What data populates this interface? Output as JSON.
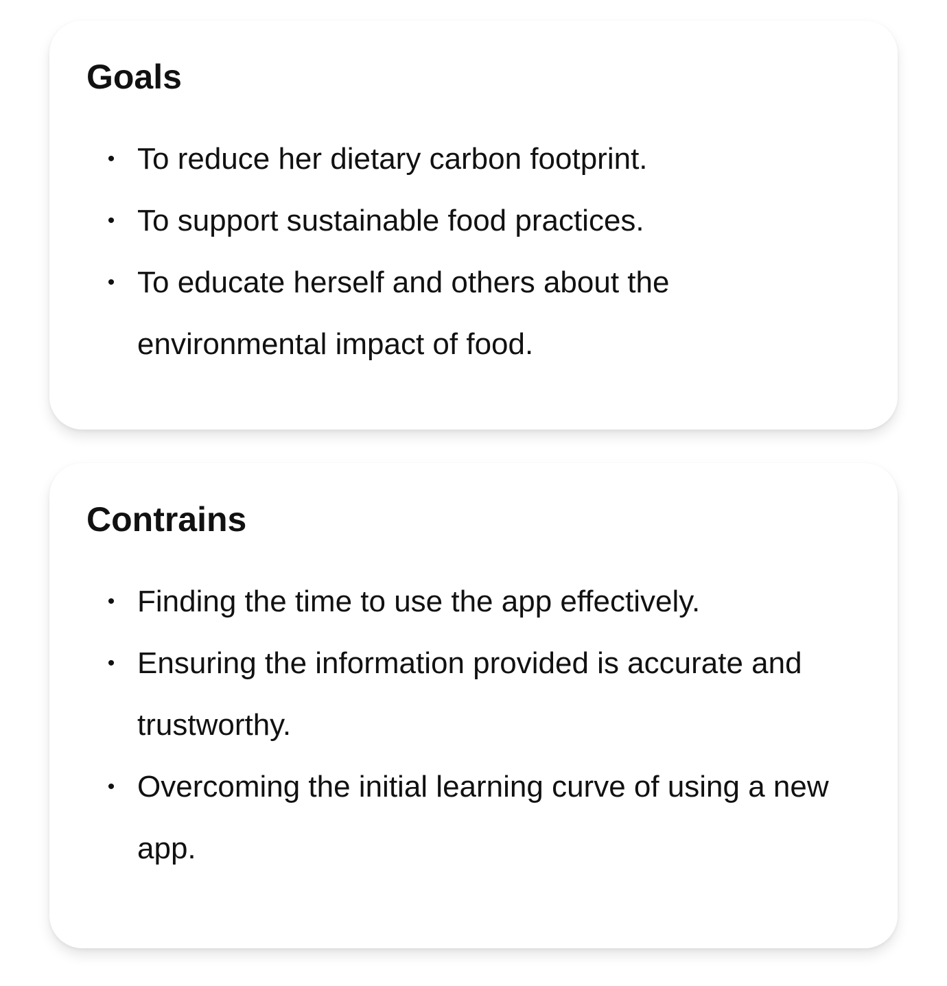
{
  "goals": {
    "title": "Goals",
    "items": [
      "To reduce her dietary carbon footprint.",
      "To support sustainable food practices.",
      "To educate herself and others about the environmental impact of food."
    ]
  },
  "constraints": {
    "title": "Contrains",
    "items": [
      "Finding the time to use the app effectively.",
      "Ensuring the information provided is accurate and trustworthy.",
      "Overcoming the initial learning curve of using a new app."
    ]
  },
  "bullet_symbol": "•"
}
